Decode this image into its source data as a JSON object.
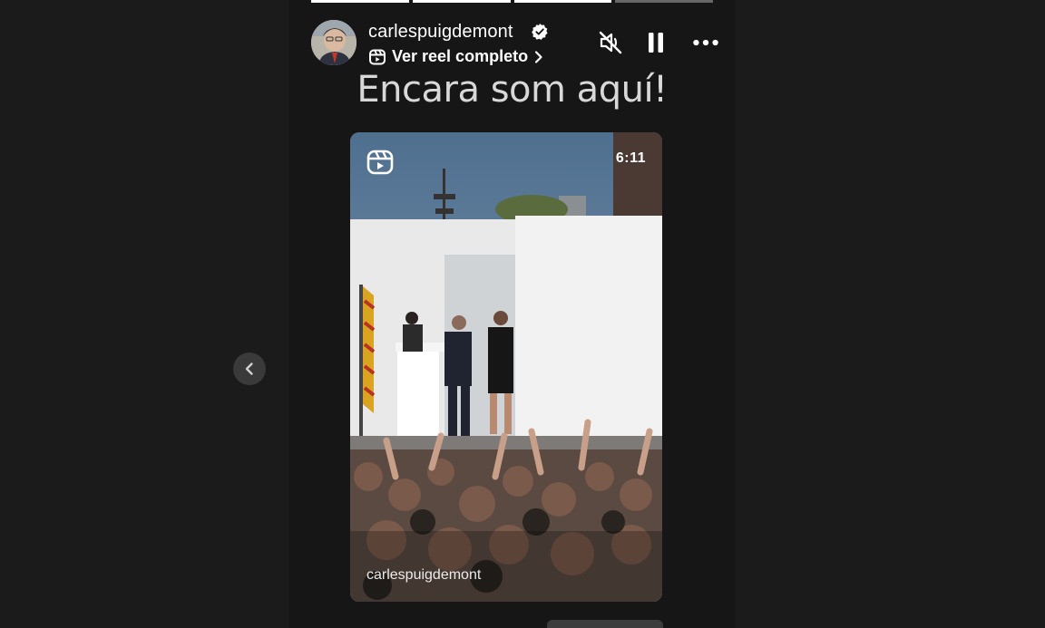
{
  "nav": {
    "prev_icon": "chevron-left-icon"
  },
  "story": {
    "progress_segments": [
      {
        "state": "done"
      },
      {
        "state": "done"
      },
      {
        "state": "done"
      },
      {
        "state": "pending"
      }
    ],
    "header": {
      "username": "carlespuigdemont",
      "verified": true,
      "reel_link_label": "Ver reel completo",
      "icons": {
        "mute": "speaker-muted-icon",
        "pause": "pause-icon",
        "more": "more-horizontal-icon"
      }
    },
    "caption": "Encara som aquí!",
    "reel_card": {
      "duration": "6:11",
      "watermark": "carlespuigdemont",
      "icon": "reels-icon"
    },
    "bottom_pill_text": "..."
  },
  "colors": {
    "background": "#1b1b1b",
    "story_background": "#161616",
    "progress_done": "#ffffff",
    "progress_pending": "#5a5a5a",
    "verified_badge": "#ffffff"
  }
}
